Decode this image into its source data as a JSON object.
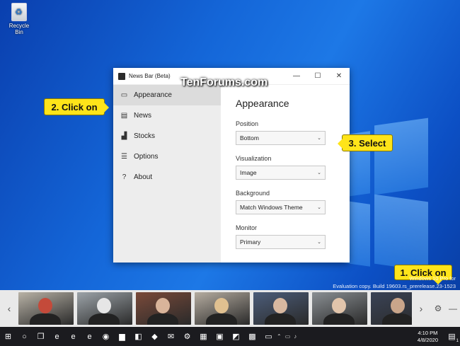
{
  "desktop": {
    "recycle_bin_label": "Recycle Bin",
    "watermark": "TenForums.com",
    "eval_line1": "Windows 10 Pro for",
    "eval_line2": "Evaluation copy. Build 19603.rs_prerelease.2",
    "eval_line2_tail": "3-1523"
  },
  "window": {
    "title": "News Bar (Beta)",
    "controls": {
      "minimize": "—",
      "maximize": "☐",
      "close": "✕"
    },
    "nav": [
      {
        "label": "Appearance",
        "icon": "monitor-icon",
        "glyph": "▭"
      },
      {
        "label": "News",
        "icon": "newspaper-icon",
        "glyph": "▤"
      },
      {
        "label": "Stocks",
        "icon": "chart-icon",
        "glyph": "▟"
      },
      {
        "label": "Options",
        "icon": "sliders-icon",
        "glyph": "☰"
      },
      {
        "label": "About",
        "icon": "info-icon",
        "glyph": "?"
      }
    ],
    "content": {
      "heading": "Appearance",
      "fields": [
        {
          "label": "Position",
          "value": "Bottom"
        },
        {
          "label": "Visualization",
          "value": "Image"
        },
        {
          "label": "Background",
          "value": "Match Windows Theme"
        },
        {
          "label": "Monitor",
          "value": "Primary"
        }
      ]
    }
  },
  "callouts": {
    "step1": "1. Click on",
    "step2": "2. Click on",
    "step3": "3. Select"
  },
  "newsbar": {
    "prev": "‹",
    "next": "›",
    "settings_glyph": "⚙",
    "minimize_glyph": "—",
    "thumbnails": [
      {
        "bg": "#b8b2a6",
        "accent": "#c44a3a"
      },
      {
        "bg": "#9ca3a8",
        "accent": "#e6e6e6"
      },
      {
        "bg": "#7a4a3a",
        "accent": "#d9b49a"
      },
      {
        "bg": "#b5aca0",
        "accent": "#e0c090"
      },
      {
        "bg": "#4c5d7a",
        "accent": "#d8b8a0"
      },
      {
        "bg": "#8a8f93",
        "accent": "#e2c5ab"
      },
      {
        "bg": "#3a4356",
        "accent": "#c9a58a"
      }
    ]
  },
  "taskbar": {
    "icons": [
      {
        "name": "windows-start-icon",
        "glyph": "⊞"
      },
      {
        "name": "search-icon",
        "glyph": "○"
      },
      {
        "name": "task-view-icon",
        "glyph": "❐"
      },
      {
        "name": "edge-icon",
        "glyph": "e"
      },
      {
        "name": "edge-beta-icon",
        "glyph": "e"
      },
      {
        "name": "edge-dev-icon",
        "glyph": "e"
      },
      {
        "name": "chrome-icon",
        "glyph": "◉"
      },
      {
        "name": "file-explorer-icon",
        "glyph": "▆"
      },
      {
        "name": "store-icon",
        "glyph": "◧"
      },
      {
        "name": "app-icon",
        "glyph": "◆"
      },
      {
        "name": "mail-icon",
        "glyph": "✉"
      },
      {
        "name": "settings-icon",
        "glyph": "⚙"
      },
      {
        "name": "app-icon-2",
        "glyph": "▦"
      },
      {
        "name": "app-icon-3",
        "glyph": "▣"
      },
      {
        "name": "app-icon-4",
        "glyph": "◩"
      },
      {
        "name": "app-icon-5",
        "glyph": "▩"
      },
      {
        "name": "news-bar-icon",
        "glyph": "▭"
      }
    ],
    "time": "4:10 PM",
    "date": "4/8/2020",
    "notification_count": "1"
  }
}
